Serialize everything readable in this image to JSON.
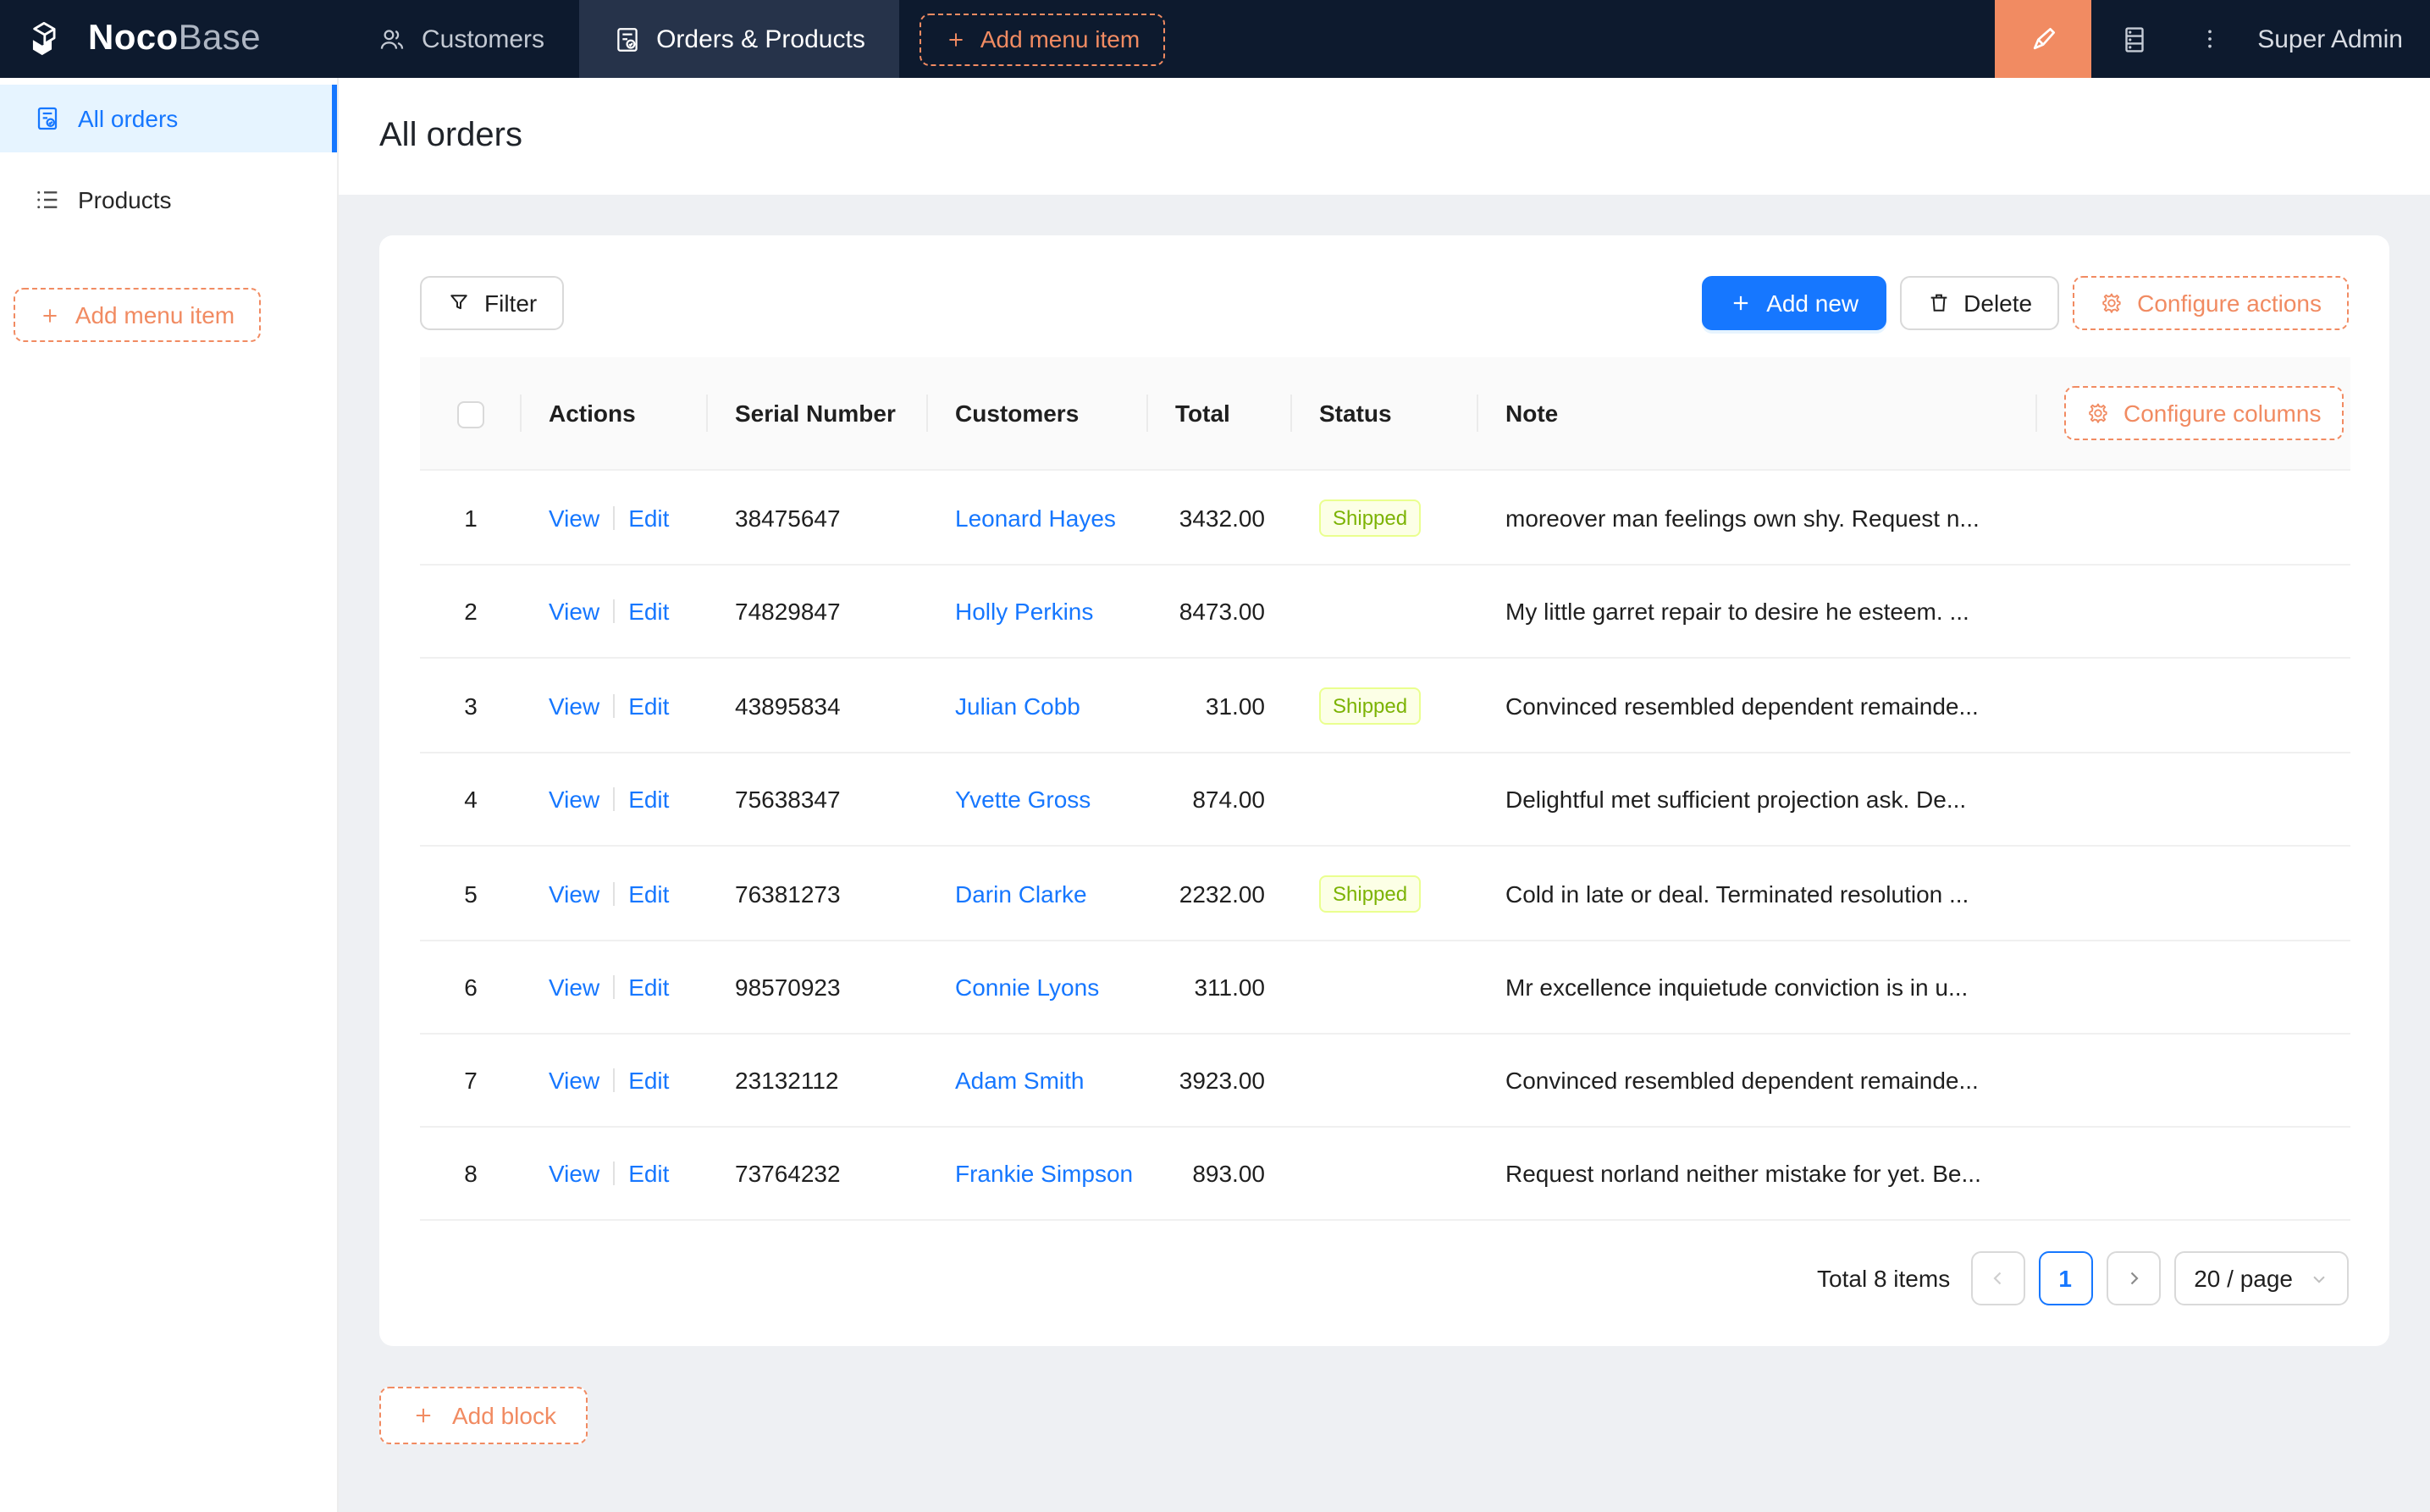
{
  "brand": {
    "bold": "Noco",
    "light": "Base"
  },
  "topnav": {
    "tabs": [
      {
        "label": "Customers"
      },
      {
        "label": "Orders & Products",
        "active": true
      }
    ],
    "add_menu_item": "Add menu item",
    "user": "Super Admin"
  },
  "sidebar": {
    "items": [
      {
        "label": "All orders",
        "active": true
      },
      {
        "label": "Products"
      }
    ],
    "add_menu_item": "Add menu item"
  },
  "page": {
    "title": "All orders"
  },
  "toolbar": {
    "filter": "Filter",
    "add_new": "Add new",
    "delete": "Delete",
    "configure_actions": "Configure actions"
  },
  "table": {
    "columns": {
      "actions": "Actions",
      "serial": "Serial Number",
      "customers": "Customers",
      "total": "Total",
      "status": "Status",
      "note": "Note"
    },
    "configure_columns": "Configure columns",
    "row_actions": {
      "view": "View",
      "edit": "Edit"
    },
    "rows": [
      {
        "index": "1",
        "serial": "38475647",
        "customer": "Leonard Hayes",
        "total": "3432.00",
        "status": "Shipped",
        "note": "moreover man feelings own shy. Request n..."
      },
      {
        "index": "2",
        "serial": "74829847",
        "customer": "Holly Perkins",
        "total": "8473.00",
        "status": "",
        "note": "My little garret repair to desire he esteem. ..."
      },
      {
        "index": "3",
        "serial": "43895834",
        "customer": "Julian Cobb",
        "total": "31.00",
        "status": "Shipped",
        "note": "Convinced resembled dependent remainde..."
      },
      {
        "index": "4",
        "serial": "75638347",
        "customer": "Yvette Gross",
        "total": "874.00",
        "status": "",
        "note": "Delightful met sufficient projection ask. De..."
      },
      {
        "index": "5",
        "serial": "76381273",
        "customer": "Darin Clarke",
        "total": "2232.00",
        "status": "Shipped",
        "note": "Cold in late or deal. Terminated resolution ..."
      },
      {
        "index": "6",
        "serial": "98570923",
        "customer": "Connie Lyons",
        "total": "311.00",
        "status": "",
        "note": "Mr excellence inquietude conviction is in u..."
      },
      {
        "index": "7",
        "serial": "23132112",
        "customer": "Adam Smith",
        "total": "3923.00",
        "status": "",
        "note": "Convinced resembled dependent remainde..."
      },
      {
        "index": "8",
        "serial": "73764232",
        "customer": "Frankie Simpson",
        "total": "893.00",
        "status": "",
        "note": "Request norland neither mistake for yet. Be..."
      }
    ]
  },
  "pagination": {
    "total": "Total 8 items",
    "current_page": "1",
    "page_size": "20 / page"
  },
  "add_block": "Add block",
  "colors": {
    "primary_blue": "#1677ff",
    "designer_orange": "#f18b62",
    "navbar_bg": "#0d1a2e",
    "navbar_active_tab_bg": "#26334a",
    "sidebar_active_bg": "#e6f4ff",
    "content_bg": "#eef0f3",
    "shipped_tag_bg": "#fcffe6",
    "shipped_tag_border": "#eaff8f",
    "shipped_tag_text": "#7cb305"
  }
}
